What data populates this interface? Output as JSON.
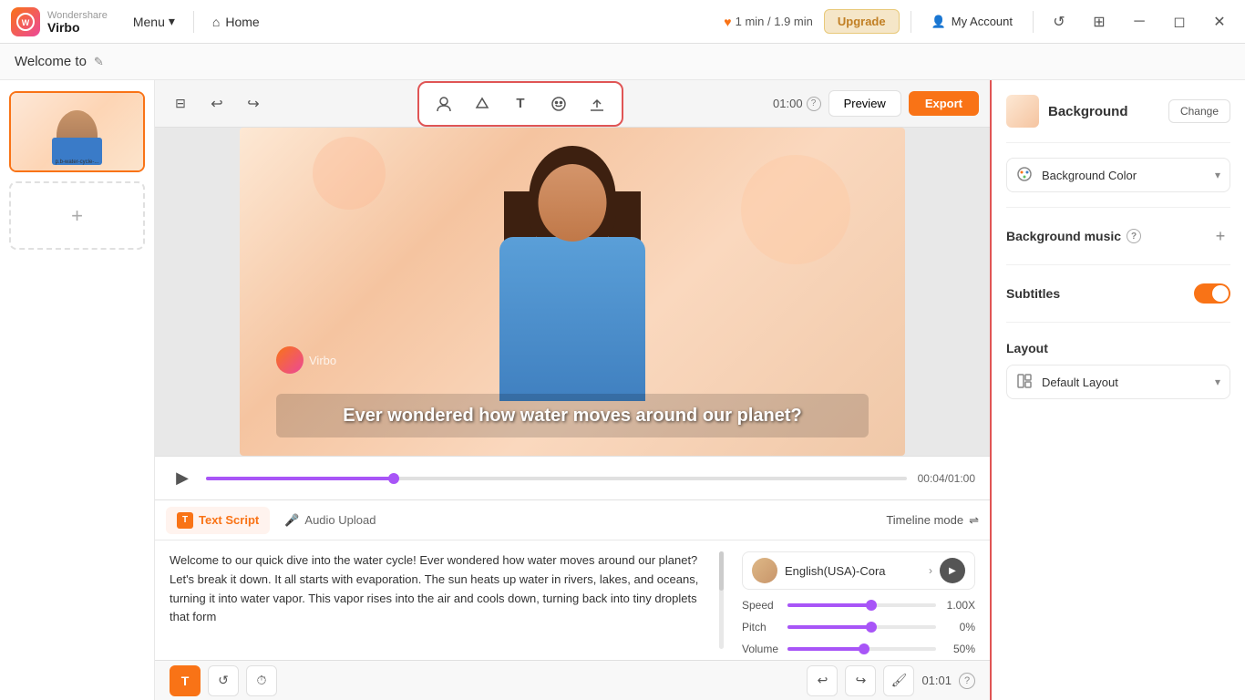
{
  "app": {
    "logo_letter": "V",
    "logo_name": "Wondershare",
    "logo_sub": "Virbo",
    "menu_label": "Menu",
    "home_label": "Home"
  },
  "topbar": {
    "duration": "1 min / 1.9 min",
    "upgrade_label": "Upgrade",
    "account_label": "My Account"
  },
  "subtitle_bar": {
    "project_title": "Welcome to"
  },
  "toolbar": {
    "time_display": "01:00",
    "preview_label": "Preview",
    "export_label": "Export"
  },
  "video": {
    "subtitle_text": "Ever wondered how water moves around our planet?",
    "watermark": "Virbo",
    "time_current": "00:04",
    "time_total": "01:00"
  },
  "script": {
    "tab_text": "Text Script",
    "tab_audio": "Audio Upload",
    "timeline_mode": "Timeline mode",
    "content": "Welcome to our quick dive into the water cycle! Ever wondered how water moves around our planet? Let's break it down. It all starts with evaporation. The sun heats up water in rivers, lakes, and oceans, turning it into water vapor. This vapor rises into the air and cools down, turning back into tiny droplets that form"
  },
  "voice": {
    "name": "English(USA)-Cora",
    "speed_label": "Speed",
    "speed_value": "1.00X",
    "speed_pct": 55,
    "pitch_label": "Pitch",
    "pitch_value": "0%",
    "pitch_pct": 55,
    "volume_label": "Volume",
    "volume_value": "50%",
    "volume_pct": 50
  },
  "bottom_toolbar": {
    "time": "01:01"
  },
  "right_panel": {
    "title": "Background",
    "change_btn": "Change",
    "bg_color_label": "Background Color",
    "bg_music_label": "Background music",
    "subtitles_label": "Subtitles",
    "layout_label": "Layout",
    "layout_default": "Default Layout"
  }
}
